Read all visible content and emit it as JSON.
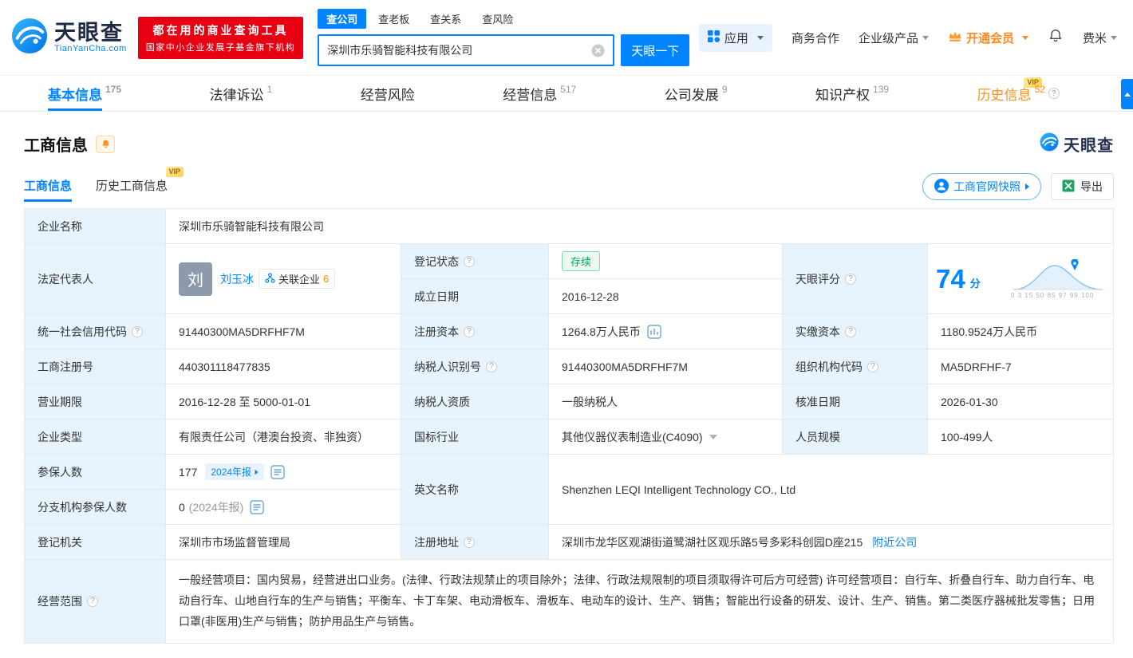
{
  "colors": {
    "accent": "#0084ff",
    "orange": "#ff9019",
    "green": "#00a561",
    "banner_red": "#e60012",
    "label_bg": "#e7f3fd"
  },
  "misc": {
    "vip": "VIP",
    "help": "?"
  },
  "header": {
    "logo": {
      "brand": "天眼查",
      "domain": "TianYanCha.com"
    },
    "banner": {
      "line1": "都在用的商业查询工具",
      "line2": "国家中小企业发展子基金旗下机构"
    },
    "search_tabs": [
      {
        "label": "查公司",
        "active": true
      },
      {
        "label": "查老板",
        "active": false
      },
      {
        "label": "查关系",
        "active": false
      },
      {
        "label": "查风险",
        "active": false
      }
    ],
    "search": {
      "value": "深圳市乐骑智能科技有限公司",
      "button_label": "天眼一下"
    },
    "nav": {
      "apps": "应用",
      "business": "商务合作",
      "enterprise": "企业级产品",
      "vip": "开通会员",
      "user": "费米"
    }
  },
  "tabs": [
    {
      "label": "基本信息",
      "count": "175"
    },
    {
      "label": "法律诉讼",
      "count": "1"
    },
    {
      "label": "经营风险",
      "count": ""
    },
    {
      "label": "经营信息",
      "count": "517"
    },
    {
      "label": "公司发展",
      "count": "9"
    },
    {
      "label": "知识产权",
      "count": "139"
    },
    {
      "label": "历史信息",
      "count": "52"
    }
  ],
  "section": {
    "title": "工商信息",
    "watermark": "天眼查",
    "subtabs": [
      {
        "label": "工商信息"
      },
      {
        "label": "历史工商信息"
      }
    ],
    "snapshot_button": "工商官网快照",
    "export_button": "导出"
  },
  "table": {
    "company_name": {
      "label": "企业名称",
      "value": "深圳市乐骑智能科技有限公司"
    },
    "legal_rep": {
      "label": "法定代表人",
      "avatar": "刘",
      "name": "刘玉冰",
      "related_label": "关联企业",
      "related_count": "6"
    },
    "reg_status": {
      "label": "登记状态",
      "value": "存续"
    },
    "establish_date": {
      "label": "成立日期",
      "value": "2016-12-28"
    },
    "score": {
      "label": "天眼评分",
      "value": "74",
      "unit": "分",
      "axis": "0 3 15 50 85 97 99 100"
    },
    "credit_code": {
      "label": "统一社会信用代码",
      "value": "91440300MA5DRFHF7M"
    },
    "reg_capital": {
      "label": "注册资本",
      "value": "1264.8万人民币"
    },
    "paid_capital": {
      "label": "实缴资本",
      "value": "1180.9524万人民币"
    },
    "reg_number": {
      "label": "工商注册号",
      "value": "440301118477835"
    },
    "taxpayer_id": {
      "label": "纳税人识别号",
      "value": "91440300MA5DRFHF7M"
    },
    "org_code": {
      "label": "组织机构代码",
      "value": "MA5DRFHF-7"
    },
    "business_term": {
      "label": "营业期限",
      "value": "2016-12-28 至 5000-01-01"
    },
    "taxpayer_quality": {
      "label": "纳税人资质",
      "value": "一般纳税人"
    },
    "approve_date": {
      "label": "核准日期",
      "value": "2026-01-30"
    },
    "company_type": {
      "label": "企业类型",
      "value": "有限责任公司（港澳台投资、非独资）"
    },
    "industry": {
      "label": "国标行业",
      "value": "其他仪器仪表制造业(C4090)"
    },
    "staff_size": {
      "label": "人员规模",
      "value": "100-499人"
    },
    "insured": {
      "label": "参保人数",
      "value": "177",
      "tag": "2024年报"
    },
    "branch_insured": {
      "label": "分支机构参保人数",
      "value": "0",
      "note": "(2024年报)"
    },
    "english_name": {
      "label": "英文名称",
      "value": "Shenzhen LEQI Intelligent Technology CO., Ltd"
    },
    "reg_authority": {
      "label": "登记机关",
      "value": "深圳市市场监督管理局"
    },
    "address": {
      "label": "注册地址",
      "value": "深圳市龙华区观湖街道鹭湖社区观乐路5号多彩科创园D座215",
      "link": "附近公司"
    },
    "business_scope": {
      "label": "经营范围",
      "value": "一般经营项目：国内贸易，经营进出口业务。(法律、行政法规禁止的项目除外；法律、行政法规限制的项目须取得许可后方可经营) 许可经营项目：自行车、折叠自行车、助力自行车、电动自行车、山地自行车的生产与销售；平衡车、卡丁车架、电动滑板车、滑板车、电动车的设计、生产、销售；智能出行设备的研发、设计、生产、销售。第二类医疗器械批发零售；日用口罩(非医用)生产与销售；防护用品生产与销售。"
    }
  }
}
